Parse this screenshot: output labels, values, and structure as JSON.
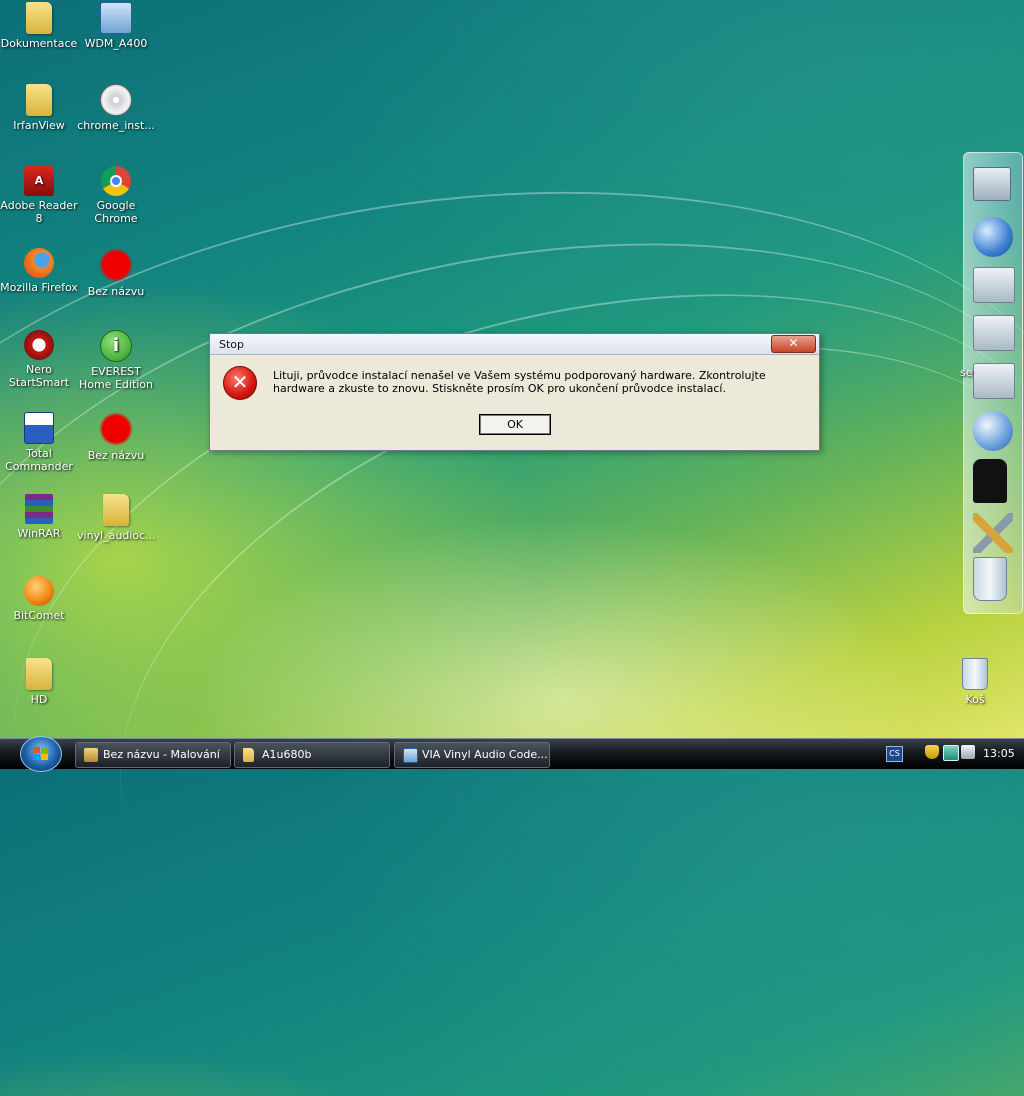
{
  "desktop": {
    "icons": [
      {
        "label": "Dokumentace",
        "icon": "folder-icon"
      },
      {
        "label": "WDM_A400",
        "icon": "installer-icon"
      },
      {
        "label": "IrfanView",
        "icon": "folder-icon"
      },
      {
        "label": "chrome_inst...",
        "icon": "installer-disc-icon"
      },
      {
        "label": "Adobe Reader 8",
        "icon": "adobe-reader-icon"
      },
      {
        "label": "Google Chrome",
        "icon": "chrome-icon"
      },
      {
        "label": "Mozilla Firefox",
        "icon": "firefox-icon"
      },
      {
        "label": "Bez názvu",
        "icon": "paint-splat-icon"
      },
      {
        "label": "Nero StartSmart",
        "icon": "nero-icon"
      },
      {
        "label": "EVEREST Home Edition",
        "icon": "everest-info-icon"
      },
      {
        "label": "Total Commander",
        "icon": "total-commander-icon"
      },
      {
        "label": "Bez názvu",
        "icon": "paint-splat-icon"
      },
      {
        "label": "WinRAR",
        "icon": "winrar-icon"
      },
      {
        "label": "vinyl_audioc...",
        "icon": "folder-icon"
      },
      {
        "label": "BitComet",
        "icon": "bitcomet-icon"
      },
      {
        "label": "HD",
        "icon": "folder-icon"
      },
      {
        "label": "Koš",
        "icon": "recycle-bin-icon"
      }
    ]
  },
  "dialog": {
    "title": "Stop",
    "close_label": "✕",
    "message": "Lituji, průvodce instalací nenašel ve Vašem systému podporovaný hardware. Zkontrolujte hardware a zkuste to znovu. Stiskněte prosím OK pro ukončení průvodce instalací.",
    "ok_label": "OK"
  },
  "dock": {
    "partial_label": "se",
    "items": [
      "computer-icon",
      "network-globe-icon",
      "documents-folder-icon",
      "music-folder-icon",
      "pictures-folder-icon",
      "internet-globe-icon",
      "tshirt-icon",
      "tools-icon",
      "recycle-bin-icon"
    ]
  },
  "taskbar": {
    "tasks": [
      {
        "label": "Bez názvu - Malování",
        "icon": "paint-icon"
      },
      {
        "label": "A1u680b",
        "icon": "folder-icon"
      },
      {
        "label": "VIA Vinyl Audio Code...",
        "icon": "installer-icon"
      }
    ],
    "language": "CS",
    "clock": "13:05"
  },
  "colors": {
    "dialog_bg": "#ece9d8",
    "error_red": "#d2160e",
    "taskbar": "#15191d"
  }
}
